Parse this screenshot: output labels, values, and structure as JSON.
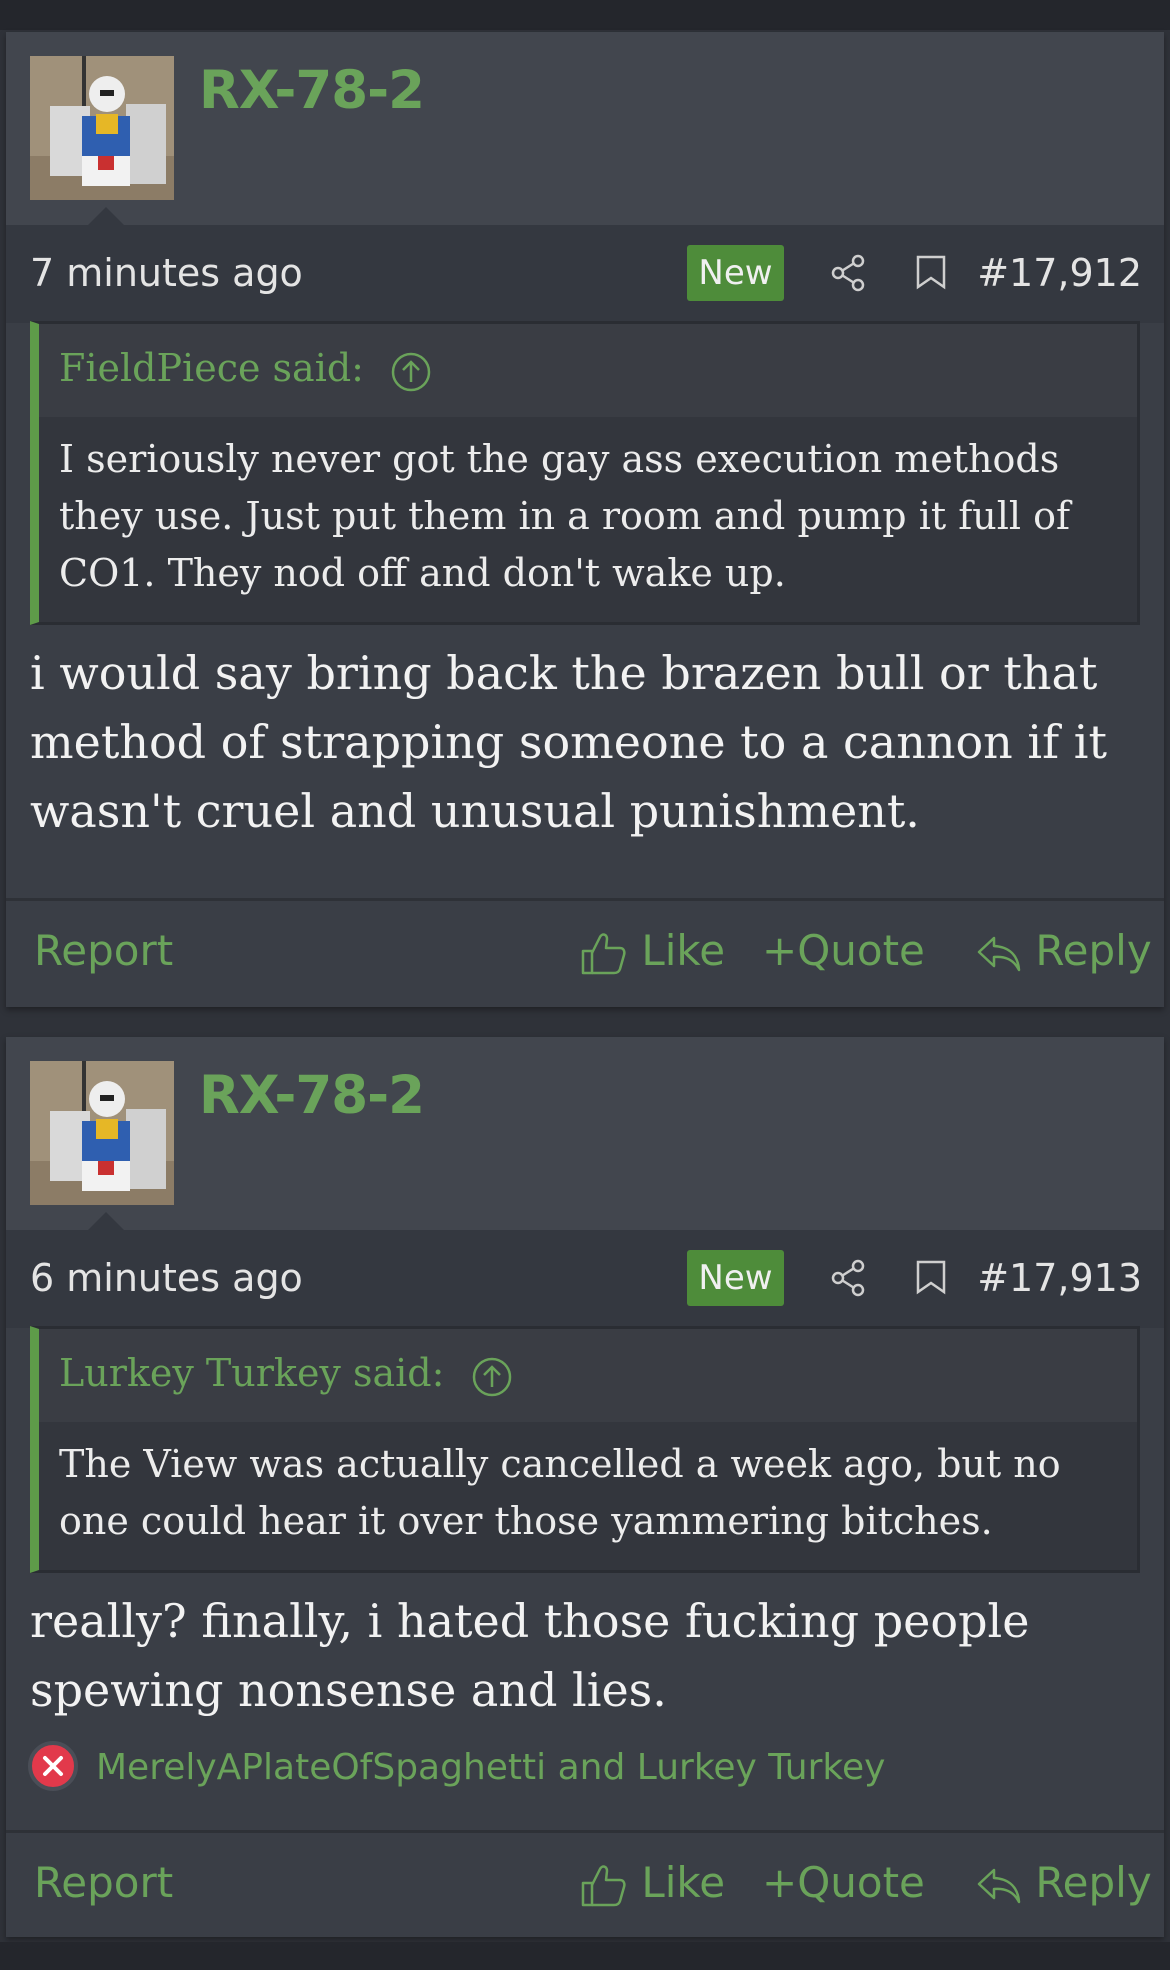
{
  "posts": [
    {
      "username": "RX-78-2",
      "time": "7 minutes ago",
      "badge": "New",
      "post_number": "#17,912",
      "quote": {
        "author": "FieldPiece said:",
        "lines": [
          "I seriously never got the gay ass execution methods",
          "they use. Just put them in a room and pump it full of",
          "CO1. They nod off and don't wake up."
        ]
      },
      "message_lines": [
        "i would say bring back the brazen bull or that",
        "method of strapping someone to a cannon if it",
        "wasn't cruel and unusual punishment."
      ],
      "actions": {
        "report": "Report",
        "like": "Like",
        "quote": "Quote",
        "reply": "Reply"
      }
    },
    {
      "username": "RX-78-2",
      "time": "6 minutes ago",
      "badge": "New",
      "post_number": "#17,913",
      "quote": {
        "author": "Lurkey Turkey said:",
        "lines": [
          "The View was actually cancelled a week ago, but no",
          "one could hear it over those yammering bitches."
        ]
      },
      "message_lines": [
        "really? finally, i hated those fucking people",
        "spewing nonsense and lies."
      ],
      "reactions": "MerelyAPlateOfSpaghetti and Lurkey Turkey",
      "actions": {
        "report": "Report",
        "like": "Like",
        "quote": "Quote",
        "reply": "Reply"
      }
    }
  ],
  "colors": {
    "accent_green": "#6aa35a",
    "badge_green": "#4e8c3a",
    "reaction_red": "#e2394b"
  },
  "icons": [
    "share-icon",
    "bookmark-icon",
    "arrow-up-circle-icon",
    "thumbs-up-icon",
    "plus-icon",
    "reply-arrow-icon",
    "x-reaction-icon"
  ]
}
